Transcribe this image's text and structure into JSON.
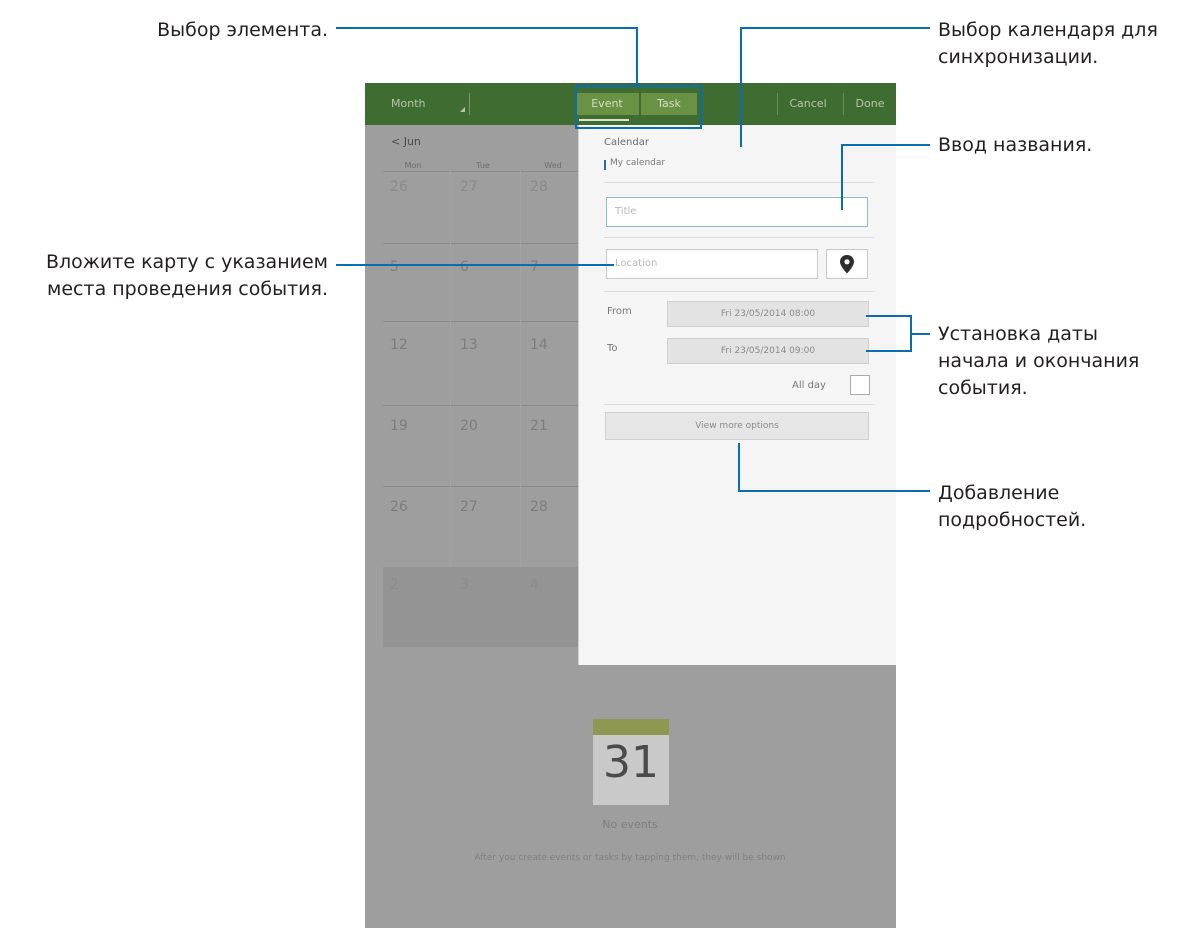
{
  "callouts": {
    "select_item": "Выбор элемента.",
    "select_calendar_line1": "Выбор календаря для",
    "select_calendar_line2": "синхронизации.",
    "enter_title": "Ввод названия.",
    "attach_map_line1": "Вложите карту с указанием",
    "attach_map_line2": "места проведения события.",
    "set_dates_line1": "Установка даты",
    "set_dates_line2": "начала и окончания",
    "set_dates_line3": "события.",
    "add_details_line1": "Добавление",
    "add_details_line2": "подробностей."
  },
  "topbar": {
    "view_select": "Month",
    "tab_event": "Event",
    "tab_task": "Task",
    "cancel": "Cancel",
    "done": "Done"
  },
  "calendar": {
    "month_nav": "< Jun",
    "weekdays": [
      "Mon",
      "Tue",
      "Wed"
    ],
    "days": [
      "26",
      "27",
      "28",
      "5",
      "6",
      "7",
      "12",
      "13",
      "14",
      "19",
      "20",
      "21",
      "26",
      "27",
      "28",
      "2",
      "3",
      "4"
    ],
    "tile_number": "31",
    "no_events": "No events",
    "empty_hint": "After you create events or tasks by tapping them, they will be shown"
  },
  "event_form": {
    "calendar_label": "Calendar",
    "calendar_value": "My calendar",
    "title_placeholder": "Title",
    "location_placeholder": "Location",
    "from_label": "From",
    "to_label": "To",
    "from_value": "Fri 23/05/2014  08:00",
    "to_value": "Fri 23/05/2014  09:00",
    "all_day_label": "All day",
    "more_options": "View more options"
  },
  "colors": {
    "callout_line": "#0a6db4",
    "topbar_green": "#3f6c30",
    "tab_green": "#6a9244"
  },
  "icons": {
    "map_button": "map-pin-icon"
  }
}
